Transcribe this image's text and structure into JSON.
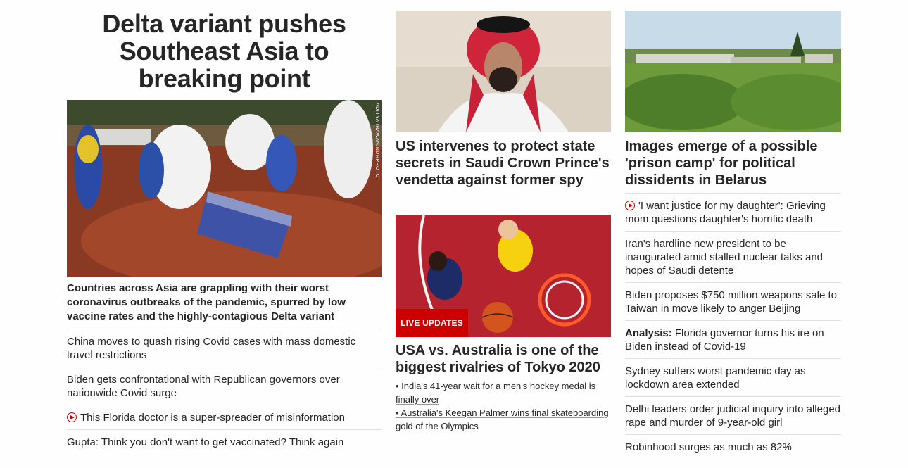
{
  "col1": {
    "hero_title": "Delta variant pushes Southeast Asia to breaking point",
    "image_credit": "ADITYA IRAWAN/NURPHOTO",
    "summary": "Countries across Asia are grappling with their worst coronavirus outbreaks of the pandemic, spurred by low vaccine rates and the highly-contagious Delta variant",
    "links": [
      {
        "text": "China moves to quash rising Covid cases with mass domestic travel restrictions",
        "video": false
      },
      {
        "text": "Biden gets confrontational with Republican governors over nationwide Covid surge",
        "video": false
      },
      {
        "text": "This Florida doctor is a super-spreader of misinformation",
        "video": true
      },
      {
        "text": "Gupta: Think you don't want to get vaccinated? Think again",
        "video": false
      }
    ]
  },
  "col2": {
    "story1_title": "US intervenes to protect state secrets in Saudi Crown Prince's vendetta against former spy",
    "live_badge": "LIVE UPDATES",
    "story2_title": "USA vs. Australia is one of the biggest rivalries of Tokyo 2020",
    "bullets": [
      "• India's 41-year wait for a men's hockey medal is finally over",
      "• Australia's Keegan Palmer wins final skateboarding gold of the Olympics"
    ]
  },
  "col3": {
    "story_title": "Images emerge of a possible 'prison camp' for political dissidents in Belarus",
    "links": [
      {
        "text": "'I want justice for my daughter': Grieving mom questions daughter's horrific death",
        "video": true,
        "prefix": ""
      },
      {
        "text": "Iran's hardline new president to be inaugurated amid stalled nuclear talks and hopes of Saudi detente",
        "video": false,
        "prefix": ""
      },
      {
        "text": "Biden proposes $750 million weapons sale to Taiwan in move likely to anger Beijing",
        "video": false,
        "prefix": ""
      },
      {
        "text": "Florida governor turns his ire on Biden instead of Covid-19",
        "video": false,
        "prefix": "Analysis:"
      },
      {
        "text": "Sydney suffers worst pandemic day as lockdown area extended",
        "video": false,
        "prefix": ""
      },
      {
        "text": "Delhi leaders order judicial inquiry into alleged rape and murder of 9-year-old girl",
        "video": false,
        "prefix": ""
      },
      {
        "text": "Robinhood surges as much as 82%",
        "video": false,
        "prefix": ""
      }
    ]
  },
  "colors": {
    "accent_red": "#cc0000",
    "text": "#262626",
    "divider": "#e0e0e0"
  }
}
